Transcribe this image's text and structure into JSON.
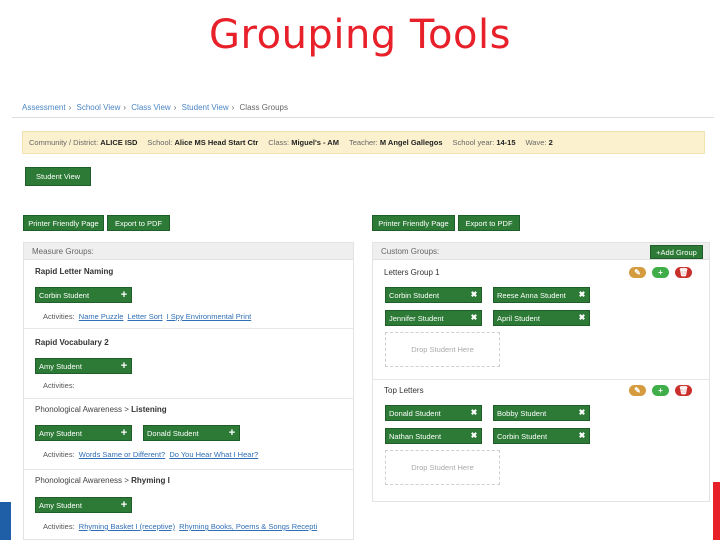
{
  "slide": {
    "title": "Grouping Tools"
  },
  "breadcrumb": [
    "Assessment",
    "School View",
    "Class View",
    "Student View",
    "Class Groups"
  ],
  "info": [
    {
      "label": "Community / District:",
      "value": "ALICE ISD"
    },
    {
      "label": "School:",
      "value": "Alice MS Head Start Ctr"
    },
    {
      "label": "Class:",
      "value": "Miguel's - AM"
    },
    {
      "label": "Teacher:",
      "value": "M Angel Gallegos"
    },
    {
      "label": "School year:",
      "value": "14-15"
    },
    {
      "label": "Wave:",
      "value": "2"
    }
  ],
  "buttons": {
    "student_view": "Student View",
    "printer_friendly": "Printer Friendly Page",
    "export_pdf": "Export to PDF",
    "add_group": "+Add Group"
  },
  "measure": {
    "header": "Measure Groups:",
    "activities_label": "Activities:",
    "groups": [
      {
        "prefix": "",
        "title": "Rapid Letter Naming",
        "students": [
          "Corbin Student"
        ],
        "activities": [
          "Name Puzzle",
          "Letter Sort",
          "I Spy Environmental Print"
        ]
      },
      {
        "prefix": "",
        "title": "Rapid Vocabulary 2",
        "students": [
          "Amy Student"
        ],
        "activities": []
      },
      {
        "prefix": "Phonological Awareness > ",
        "title": "Listening",
        "students": [
          "Amy Student",
          "Donald Student"
        ],
        "activities": [
          "Words Same or Different?",
          "Do You Hear What I Hear?"
        ]
      },
      {
        "prefix": "Phonological Awareness > ",
        "title": "Rhyming I",
        "students": [
          "Amy Student"
        ],
        "activities": [
          "Rhyming Basket I (receptive)",
          "Rhyming Books, Poems & Songs Recepti"
        ]
      }
    ]
  },
  "custom": {
    "header": "Custom Groups:",
    "drop_text": "Drop Student Here",
    "groups": [
      {
        "title": "Letters Group 1",
        "students": [
          "Corbin Student",
          "Reese Anna Student",
          "Jennifer Student",
          "April Student"
        ]
      },
      {
        "title": "Top Letters",
        "students": [
          "Donald Student",
          "Bobby Student",
          "Nathan Student",
          "Corbin Student"
        ]
      }
    ]
  },
  "icons": {
    "add": "plus-icon",
    "remove": "close-icon",
    "edit": "pencil-icon",
    "delete": "trash-icon"
  },
  "colors": {
    "title_red": "#e8202a",
    "button_green": "#2c7a36",
    "link_blue": "#2f6fb5",
    "info_bg": "#fbf1cf"
  }
}
